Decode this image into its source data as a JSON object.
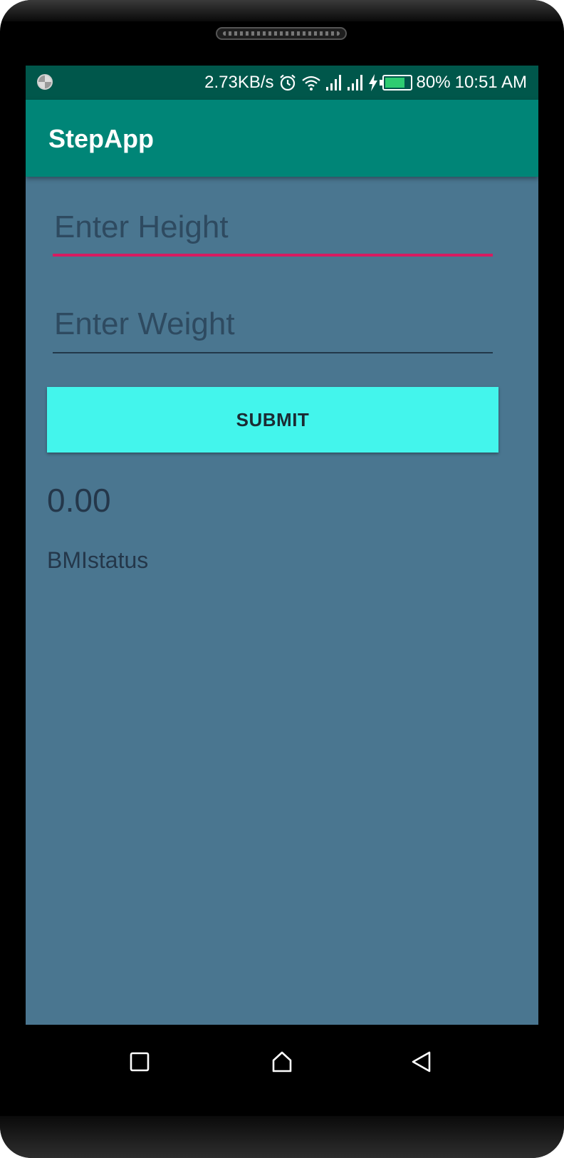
{
  "status_bar": {
    "network_speed": "2.73KB/s",
    "battery_percent": "80%",
    "battery_level": 0.8,
    "time": "10:51 AM",
    "icons": [
      "loading-icon",
      "alarm-icon",
      "wifi-icon",
      "signal-icon",
      "signal-icon",
      "charging-icon",
      "battery-icon"
    ]
  },
  "app_bar": {
    "title": "StepApp"
  },
  "form": {
    "height_placeholder": "Enter Height",
    "height_value": "",
    "weight_placeholder": "Enter Weight",
    "weight_value": "",
    "submit_label": "SUBMIT"
  },
  "result": {
    "bmi_value": "0.00",
    "bmi_status": "BMIstatus"
  },
  "nav_bar": {
    "buttons": [
      "recent-apps",
      "home",
      "back"
    ]
  },
  "colors": {
    "status_bar": "#00574b",
    "app_bar": "#008577",
    "background": "#4a7690",
    "accent": "#d81b60",
    "button": "#43f5ec"
  }
}
